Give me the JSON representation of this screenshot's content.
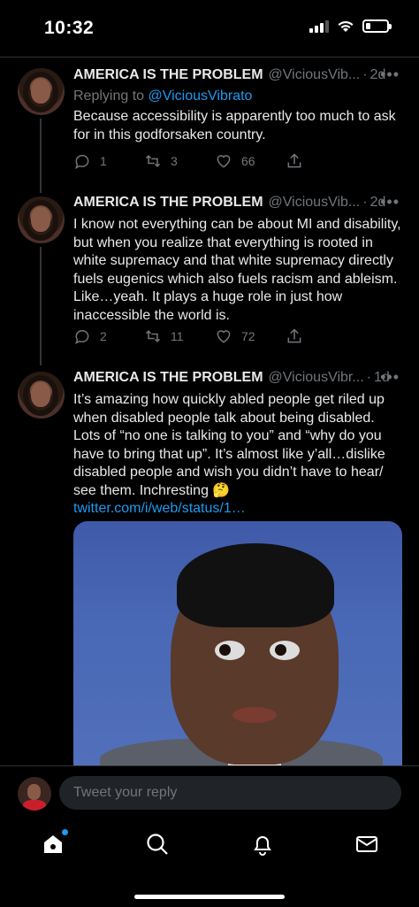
{
  "status_bar": {
    "time": "10:32"
  },
  "tweets": [
    {
      "name": "AMERICA IS THE PROBLEM",
      "handle": "@ViciousVib...",
      "age": "2d",
      "replying_to_prefix": "Replying to",
      "replying_to_handle": "@ViciousVibrato",
      "text": "Because accessibility is apparently too much to ask for in this godforsaken country.",
      "replies": "1",
      "retweets": "3",
      "likes": "66"
    },
    {
      "name": "AMERICA IS THE PROBLEM",
      "handle": "@ViciousVib...",
      "age": "2d",
      "text": "I know not everything can be about MI and disability, but when you realize that everything is rooted in white supremacy and that white supremacy directly fuels eugenics which also fuels racism and ableism. Like…yeah. It plays a huge role in just how inaccessible the world is.",
      "replies": "2",
      "retweets": "11",
      "likes": "72"
    },
    {
      "name": "AMERICA IS THE PROBLEM",
      "handle": "@ViciousVibr...",
      "age": "1d",
      "text": "It’s amazing how quickly abled people get riled up when disabled people talk about being disabled. Lots of “no one is talking to you” and “why do you have to bring that up”. It’s almost like y’all…dislike disabled people and wish you didn’t have to hear/ see them. Inchresting 🤔",
      "link": "twitter.com/i/web/status/1…"
    }
  ],
  "reply_bar": {
    "placeholder": "Tweet your reply"
  },
  "icons": {
    "more": "more-dots-icon",
    "reply": "reply-icon",
    "retweet": "retweet-icon",
    "like": "heart-icon",
    "share": "share-icon",
    "tabs": [
      "home-icon",
      "search-icon",
      "notifications-icon",
      "messages-icon"
    ]
  },
  "colors": {
    "accent": "#1d9bf0",
    "muted": "#71767b",
    "background": "#000000"
  }
}
